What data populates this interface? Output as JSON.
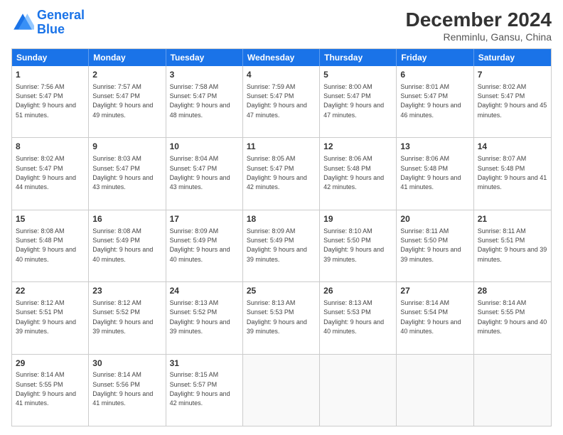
{
  "logo": {
    "line1": "General",
    "line2": "Blue"
  },
  "title": "December 2024",
  "subtitle": "Renminlu, Gansu, China",
  "header_days": [
    "Sunday",
    "Monday",
    "Tuesday",
    "Wednesday",
    "Thursday",
    "Friday",
    "Saturday"
  ],
  "weeks": [
    [
      {
        "day": "1",
        "sunrise": "7:56 AM",
        "sunset": "5:47 PM",
        "daylight": "9 hours and 51 minutes."
      },
      {
        "day": "2",
        "sunrise": "7:57 AM",
        "sunset": "5:47 PM",
        "daylight": "9 hours and 49 minutes."
      },
      {
        "day": "3",
        "sunrise": "7:58 AM",
        "sunset": "5:47 PM",
        "daylight": "9 hours and 48 minutes."
      },
      {
        "day": "4",
        "sunrise": "7:59 AM",
        "sunset": "5:47 PM",
        "daylight": "9 hours and 47 minutes."
      },
      {
        "day": "5",
        "sunrise": "8:00 AM",
        "sunset": "5:47 PM",
        "daylight": "9 hours and 47 minutes."
      },
      {
        "day": "6",
        "sunrise": "8:01 AM",
        "sunset": "5:47 PM",
        "daylight": "9 hours and 46 minutes."
      },
      {
        "day": "7",
        "sunrise": "8:02 AM",
        "sunset": "5:47 PM",
        "daylight": "9 hours and 45 minutes."
      }
    ],
    [
      {
        "day": "8",
        "sunrise": "8:02 AM",
        "sunset": "5:47 PM",
        "daylight": "9 hours and 44 minutes."
      },
      {
        "day": "9",
        "sunrise": "8:03 AM",
        "sunset": "5:47 PM",
        "daylight": "9 hours and 43 minutes."
      },
      {
        "day": "10",
        "sunrise": "8:04 AM",
        "sunset": "5:47 PM",
        "daylight": "9 hours and 43 minutes."
      },
      {
        "day": "11",
        "sunrise": "8:05 AM",
        "sunset": "5:47 PM",
        "daylight": "9 hours and 42 minutes."
      },
      {
        "day": "12",
        "sunrise": "8:06 AM",
        "sunset": "5:48 PM",
        "daylight": "9 hours and 42 minutes."
      },
      {
        "day": "13",
        "sunrise": "8:06 AM",
        "sunset": "5:48 PM",
        "daylight": "9 hours and 41 minutes."
      },
      {
        "day": "14",
        "sunrise": "8:07 AM",
        "sunset": "5:48 PM",
        "daylight": "9 hours and 41 minutes."
      }
    ],
    [
      {
        "day": "15",
        "sunrise": "8:08 AM",
        "sunset": "5:48 PM",
        "daylight": "9 hours and 40 minutes."
      },
      {
        "day": "16",
        "sunrise": "8:08 AM",
        "sunset": "5:49 PM",
        "daylight": "9 hours and 40 minutes."
      },
      {
        "day": "17",
        "sunrise": "8:09 AM",
        "sunset": "5:49 PM",
        "daylight": "9 hours and 40 minutes."
      },
      {
        "day": "18",
        "sunrise": "8:09 AM",
        "sunset": "5:49 PM",
        "daylight": "9 hours and 39 minutes."
      },
      {
        "day": "19",
        "sunrise": "8:10 AM",
        "sunset": "5:50 PM",
        "daylight": "9 hours and 39 minutes."
      },
      {
        "day": "20",
        "sunrise": "8:11 AM",
        "sunset": "5:50 PM",
        "daylight": "9 hours and 39 minutes."
      },
      {
        "day": "21",
        "sunrise": "8:11 AM",
        "sunset": "5:51 PM",
        "daylight": "9 hours and 39 minutes."
      }
    ],
    [
      {
        "day": "22",
        "sunrise": "8:12 AM",
        "sunset": "5:51 PM",
        "daylight": "9 hours and 39 minutes."
      },
      {
        "day": "23",
        "sunrise": "8:12 AM",
        "sunset": "5:52 PM",
        "daylight": "9 hours and 39 minutes."
      },
      {
        "day": "24",
        "sunrise": "8:13 AM",
        "sunset": "5:52 PM",
        "daylight": "9 hours and 39 minutes."
      },
      {
        "day": "25",
        "sunrise": "8:13 AM",
        "sunset": "5:53 PM",
        "daylight": "9 hours and 39 minutes."
      },
      {
        "day": "26",
        "sunrise": "8:13 AM",
        "sunset": "5:53 PM",
        "daylight": "9 hours and 40 minutes."
      },
      {
        "day": "27",
        "sunrise": "8:14 AM",
        "sunset": "5:54 PM",
        "daylight": "9 hours and 40 minutes."
      },
      {
        "day": "28",
        "sunrise": "8:14 AM",
        "sunset": "5:55 PM",
        "daylight": "9 hours and 40 minutes."
      }
    ],
    [
      {
        "day": "29",
        "sunrise": "8:14 AM",
        "sunset": "5:55 PM",
        "daylight": "9 hours and 41 minutes."
      },
      {
        "day": "30",
        "sunrise": "8:14 AM",
        "sunset": "5:56 PM",
        "daylight": "9 hours and 41 minutes."
      },
      {
        "day": "31",
        "sunrise": "8:15 AM",
        "sunset": "5:57 PM",
        "daylight": "9 hours and 42 minutes."
      },
      null,
      null,
      null,
      null
    ]
  ]
}
